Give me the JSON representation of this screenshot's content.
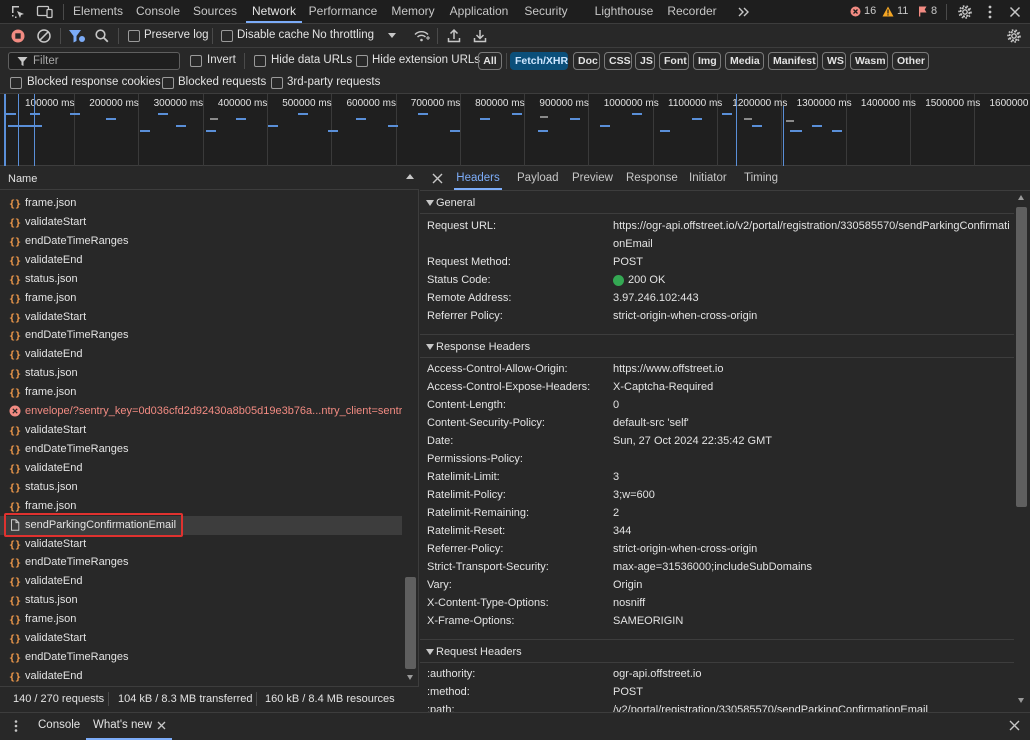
{
  "main_tabs": [
    {
      "label": "Elements"
    },
    {
      "label": "Console"
    },
    {
      "label": "Sources"
    },
    {
      "label": "Network"
    },
    {
      "label": "Performance"
    },
    {
      "label": "Memory"
    },
    {
      "label": "Application"
    },
    {
      "label": "Security"
    },
    {
      "label": "Lighthouse"
    },
    {
      "label": "Recorder"
    }
  ],
  "counters": {
    "errors": "16",
    "warnings": "11",
    "issues": "8"
  },
  "toolbar": {
    "preserve_log": "Preserve log",
    "disable_cache": "Disable cache",
    "throttling": "No throttling",
    "filter_placeholder": "Filter",
    "invert": "Invert",
    "hide_data_urls": "Hide data URLs",
    "hide_extension_urls": "Hide extension URLs",
    "blocked_cookies": "Blocked response cookies",
    "blocked_requests": "Blocked requests",
    "third_party": "3rd-party requests"
  },
  "type_filters": [
    {
      "label": "All"
    },
    {
      "label": "Fetch/XHR"
    },
    {
      "label": "Doc"
    },
    {
      "label": "CSS"
    },
    {
      "label": "JS"
    },
    {
      "label": "Font"
    },
    {
      "label": "Img"
    },
    {
      "label": "Media"
    },
    {
      "label": "Manifest"
    },
    {
      "label": "WS"
    },
    {
      "label": "Wasm"
    },
    {
      "label": "Other"
    }
  ],
  "timeline_ticks": [
    "100000 ms",
    "200000 ms",
    "300000 ms",
    "400000 ms",
    "500000 ms",
    "600000 ms",
    "700000 ms",
    "800000 ms",
    "900000 ms",
    "1000000 ms",
    "1100000 ms",
    "1200000 ms",
    "1300000 ms",
    "1400000 ms",
    "1500000 ms",
    "1600000 ms"
  ],
  "list": {
    "header": "Name",
    "rows": [
      {
        "name": "frame.json",
        "type": "xhr"
      },
      {
        "name": "validateStart",
        "type": "xhr"
      },
      {
        "name": "endDateTimeRanges",
        "type": "xhr"
      },
      {
        "name": "validateEnd",
        "type": "xhr"
      },
      {
        "name": "status.json",
        "type": "xhr"
      },
      {
        "name": "frame.json",
        "type": "xhr"
      },
      {
        "name": "validateStart",
        "type": "xhr"
      },
      {
        "name": "endDateTimeRanges",
        "type": "xhr"
      },
      {
        "name": "validateEnd",
        "type": "xhr"
      },
      {
        "name": "status.json",
        "type": "xhr"
      },
      {
        "name": "frame.json",
        "type": "xhr"
      },
      {
        "name": "envelope/?sentry_key=0d036cfd2d92430a8b05d19e3b76a...ntry_client=sentr...",
        "type": "error"
      },
      {
        "name": "validateStart",
        "type": "xhr"
      },
      {
        "name": "endDateTimeRanges",
        "type": "xhr"
      },
      {
        "name": "validateEnd",
        "type": "xhr"
      },
      {
        "name": "status.json",
        "type": "xhr"
      },
      {
        "name": "frame.json",
        "type": "xhr"
      },
      {
        "name": "sendParkingConfirmationEmail",
        "type": "doc"
      },
      {
        "name": "validateStart",
        "type": "xhr"
      },
      {
        "name": "endDateTimeRanges",
        "type": "xhr"
      },
      {
        "name": "validateEnd",
        "type": "xhr"
      },
      {
        "name": "status.json",
        "type": "xhr"
      },
      {
        "name": "frame.json",
        "type": "xhr"
      },
      {
        "name": "validateStart",
        "type": "xhr"
      },
      {
        "name": "endDateTimeRanges",
        "type": "xhr"
      },
      {
        "name": "validateEnd",
        "type": "xhr"
      }
    ]
  },
  "status_bar": {
    "requests": "140 / 270 requests",
    "transferred": "104 kB / 8.3 MB transferred",
    "resources": "160 kB / 8.4 MB resources"
  },
  "detail_tabs": [
    {
      "label": "Headers"
    },
    {
      "label": "Payload"
    },
    {
      "label": "Preview"
    },
    {
      "label": "Response"
    },
    {
      "label": "Initiator"
    },
    {
      "label": "Timing"
    }
  ],
  "general": {
    "title": "General",
    "request_url_key": "Request URL:",
    "request_url_line1": "https://ogr-api.offstreet.io/v2/portal/registration/330585570/sendParkingConfirmati",
    "request_url_line2": "onEmail",
    "method_key": "Request Method:",
    "method_val": "POST",
    "status_key": "Status Code:",
    "status_val": "200 OK",
    "remote_key": "Remote Address:",
    "remote_val": "3.97.246.102:443",
    "referrer_key": "Referrer Policy:",
    "referrer_val": "strict-origin-when-cross-origin",
    "status_color": "#34a853"
  },
  "response_headers": {
    "title": "Response Headers",
    "items": [
      {
        "k": "Access-Control-Allow-Origin:",
        "v": "https://www.offstreet.io"
      },
      {
        "k": "Access-Control-Expose-Headers:",
        "v": "X-Captcha-Required"
      },
      {
        "k": "Content-Length:",
        "v": "0"
      },
      {
        "k": "Content-Security-Policy:",
        "v": "default-src 'self'"
      },
      {
        "k": "Date:",
        "v": "Sun, 27 Oct 2024 22:35:42 GMT"
      },
      {
        "k": "Permissions-Policy:",
        "v": ""
      },
      {
        "k": "Ratelimit-Limit:",
        "v": "3"
      },
      {
        "k": "Ratelimit-Policy:",
        "v": "3;w=600"
      },
      {
        "k": "Ratelimit-Remaining:",
        "v": "2"
      },
      {
        "k": "Ratelimit-Reset:",
        "v": "344"
      },
      {
        "k": "Referrer-Policy:",
        "v": "strict-origin-when-cross-origin"
      },
      {
        "k": "Strict-Transport-Security:",
        "v": "max-age=31536000;includeSubDomains"
      },
      {
        "k": "Vary:",
        "v": "Origin"
      },
      {
        "k": "X-Content-Type-Options:",
        "v": "nosniff"
      },
      {
        "k": "X-Frame-Options:",
        "v": "SAMEORIGIN"
      }
    ]
  },
  "request_headers": {
    "title": "Request Headers",
    "items": [
      {
        "k": ":authority:",
        "v": "ogr-api.offstreet.io"
      },
      {
        "k": ":method:",
        "v": "POST"
      },
      {
        "k": ":path:",
        "v": "/v2/portal/registration/330585570/sendParkingConfirmationEmail"
      }
    ]
  },
  "drawer": {
    "console": "Console",
    "whats_new": "What's new"
  }
}
